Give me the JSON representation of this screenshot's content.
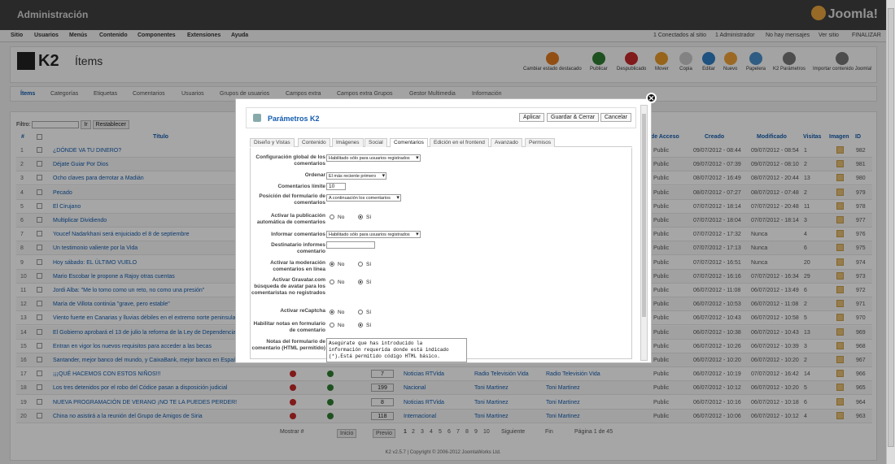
{
  "admin_title": "Administración",
  "joomla_logo": "Joomla!",
  "menu": [
    "Sitio",
    "Usuarios",
    "Menús",
    "Contenido",
    "Componentes",
    "Extensiones",
    "Ayuda"
  ],
  "status": [
    "1 Conectados al sitio",
    "1 Administrador",
    "No hay mensajes",
    "Ver sitio",
    "FINALIZAR"
  ],
  "page_title": "Ítems",
  "k2_logo": "K2",
  "toolbar": [
    {
      "label": "Cambiar estado destacado",
      "color": "#e07a1f"
    },
    {
      "label": "Publicar",
      "color": "#2e7d32"
    },
    {
      "label": "Despublicado",
      "color": "#c62828"
    },
    {
      "label": "Mover",
      "color": "#e89a2a"
    },
    {
      "label": "Copia",
      "color": "#c9c9c9"
    },
    {
      "label": "Editar",
      "color": "#2f7fc5"
    },
    {
      "label": "Nuevo",
      "color": "#f0a23a"
    },
    {
      "label": "Papelera",
      "color": "#4a8fc9"
    },
    {
      "label": "K2 Parámetros",
      "color": "#777777"
    },
    {
      "label": "Importar contenido Joomla!",
      "color": "#777777"
    }
  ],
  "subnav": [
    "Ítems",
    "Categorías",
    "Etiquetas",
    "Comentarios",
    "Usuarios",
    "Grupos de usuarios",
    "Campos extra",
    "Campos extra Grupos",
    "Gestor Multimedia",
    "Información"
  ],
  "filter": {
    "label": "Filtro:",
    "go": "Ir",
    "reset": "Restablecer"
  },
  "columns": {
    "num": "#",
    "title": "Título",
    "access": "de Acceso",
    "created": "Creado",
    "modified": "Modificado",
    "hits": "Visitas",
    "image": "Imagen",
    "id": "ID"
  },
  "rows": [
    {
      "n": "1",
      "title": "¿DÓNDE VA TU DINERO?",
      "order": "",
      "cat": "",
      "author": "",
      "moder": "",
      "access": "Public",
      "created": "09/07/2012 - 08:44",
      "modified": "09/07/2012 - 08:54",
      "hits": "1",
      "id": "982"
    },
    {
      "n": "2",
      "title": "Déjate Guiar Por Dios",
      "order": "",
      "cat": "",
      "author": "",
      "moder": "",
      "access": "Public",
      "created": "09/07/2012 - 07:39",
      "modified": "09/07/2012 - 08:10",
      "hits": "2",
      "id": "981"
    },
    {
      "n": "3",
      "title": "Ocho claves para derrotar a Madián",
      "order": "",
      "cat": "",
      "author": "",
      "moder": "",
      "access": "Public",
      "created": "08/07/2012 - 16:49",
      "modified": "08/07/2012 - 20:44",
      "hits": "13",
      "id": "980"
    },
    {
      "n": "4",
      "title": "Pecado",
      "order": "",
      "cat": "",
      "author": "",
      "moder": "",
      "access": "Public",
      "created": "08/07/2012 - 07:27",
      "modified": "08/07/2012 - 07:48",
      "hits": "2",
      "id": "979"
    },
    {
      "n": "5",
      "title": "El Cirujano",
      "order": "",
      "cat": "",
      "author": "",
      "moder": "",
      "access": "Public",
      "created": "07/07/2012 - 18:14",
      "modified": "07/07/2012 - 20:48",
      "hits": "11",
      "id": "978"
    },
    {
      "n": "6",
      "title": "Multiplicar Dividiendo",
      "order": "",
      "cat": "",
      "author": "",
      "moder": "",
      "access": "Public",
      "created": "07/07/2012 - 18:04",
      "modified": "07/07/2012 - 18:14",
      "hits": "3",
      "id": "977"
    },
    {
      "n": "7",
      "title": "Youcef Nadarkhani será enjuiciado el 8 de septiembre",
      "order": "",
      "cat": "",
      "author": "",
      "moder": "",
      "access": "Public",
      "created": "07/07/2012 - 17:32",
      "modified": "Nunca",
      "hits": "4",
      "id": "976"
    },
    {
      "n": "8",
      "title": "Un testimonio valiente por la Vida",
      "order": "",
      "cat": "",
      "author": "",
      "moder": "",
      "access": "Public",
      "created": "07/07/2012 - 17:13",
      "modified": "Nunca",
      "hits": "6",
      "id": "975"
    },
    {
      "n": "9",
      "title": "Hoy sábado: EL ÚLTIMO VUELO",
      "order": "",
      "cat": "",
      "author": "",
      "moder": "",
      "access": "Public",
      "created": "07/07/2012 - 16:51",
      "modified": "Nunca",
      "hits": "20",
      "id": "974"
    },
    {
      "n": "10",
      "title": "Mario Escobar le propone a Rajoy otras cuentas",
      "order": "",
      "cat": "",
      "author": "",
      "moder": "",
      "access": "Public",
      "created": "07/07/2012 - 16:16",
      "modified": "07/07/2012 - 16:34",
      "hits": "29",
      "id": "973"
    },
    {
      "n": "11",
      "title": "Jordi Alba: \"Me lo tomo como un reto, no como una presión\"",
      "order": "",
      "cat": "",
      "author": "",
      "moder": "",
      "access": "Public",
      "created": "06/07/2012 - 11:08",
      "modified": "06/07/2012 - 13:49",
      "hits": "6",
      "id": "972"
    },
    {
      "n": "12",
      "title": "María de Villota continúa \"grave, pero estable\"",
      "order": "",
      "cat": "",
      "author": "",
      "moder": "",
      "access": "Public",
      "created": "06/07/2012 - 10:53",
      "modified": "06/07/2012 - 11:08",
      "hits": "2",
      "id": "971"
    },
    {
      "n": "13",
      "title": "Viento fuerte en Canarias y lluvias débiles en el extremo norte peninsular",
      "order": "",
      "cat": "",
      "author": "",
      "moder": "",
      "access": "Public",
      "created": "06/07/2012 - 10:43",
      "modified": "06/07/2012 - 10:58",
      "hits": "5",
      "id": "970"
    },
    {
      "n": "14",
      "title": "El Gobierno aprobará el 13 de julio la reforma de la Ley de Dependencia",
      "order": "",
      "cat": "",
      "author": "",
      "moder": "",
      "access": "Public",
      "created": "06/07/2012 - 10:38",
      "modified": "06/07/2012 - 10:43",
      "hits": "13",
      "id": "969"
    },
    {
      "n": "15",
      "title": "Entran en vigor los nuevos requisitos para acceder a las becas",
      "order": "",
      "cat": "",
      "author": "",
      "moder": "",
      "access": "Public",
      "created": "06/07/2012 - 10:26",
      "modified": "06/07/2012 - 10:39",
      "hits": "3",
      "id": "968"
    },
    {
      "n": "16",
      "title": "Santander, mejor banco del mundo, y CaixaBank, mejor banco en España",
      "order": "",
      "cat": "",
      "author": "",
      "moder": "",
      "access": "Public",
      "created": "06/07/2012 - 10:20",
      "modified": "06/07/2012 - 10:20",
      "hits": "2",
      "id": "967"
    },
    {
      "n": "17",
      "title": "¡¡¡QUÉ HACEMOS CON ESTOS NIÑOS!!!",
      "order": "7",
      "cat": "Noticias RTVida",
      "author": "Radio Televisión Vida",
      "moder": "Radio Televisión Vida",
      "access": "Public",
      "created": "06/07/2012 - 10:19",
      "modified": "07/07/2012 - 16:42",
      "hits": "14",
      "id": "966"
    },
    {
      "n": "18",
      "title": "Los tres detenidos por el robo del Códice pasan a disposición judicial",
      "order": "199",
      "cat": "Nacional",
      "author": "Toni Martinez",
      "moder": "Toni Martinez",
      "access": "Public",
      "created": "06/07/2012 - 10:12",
      "modified": "06/07/2012 - 10:20",
      "hits": "5",
      "id": "965"
    },
    {
      "n": "19",
      "title": "NUEVA PROGRAMACIÓN DE VERANO ¡NO TE LA PUEDES PERDER!",
      "order": "8",
      "cat": "Noticias RTVida",
      "author": "Toni Martinez",
      "moder": "Toni Martinez",
      "access": "Public",
      "created": "06/07/2012 - 10:16",
      "modified": "06/07/2012 - 10:18",
      "hits": "6",
      "id": "964"
    },
    {
      "n": "20",
      "title": "China no asistirá a la reunión del Grupo de Amigos de Siria",
      "order": "118",
      "cat": "Internacional",
      "author": "Toni Martinez",
      "moder": "Toni Martinez",
      "access": "Public",
      "created": "06/07/2012 - 10:06",
      "modified": "06/07/2012 - 10:12",
      "hits": "4",
      "id": "963"
    }
  ],
  "pager": {
    "show": "Mostrar #",
    "start": "Inicio",
    "prev": "Previo",
    "pages": [
      "1",
      "2",
      "3",
      "4",
      "5",
      "6",
      "7",
      "8",
      "9",
      "10"
    ],
    "next": "Siguiente",
    "end": "Fin",
    "info": "Página 1 de 45"
  },
  "footer": "K2 v2.5.7 | Copyright © 2006-2012 JoomlaWorks Ltd.",
  "modal": {
    "title": "Parámetros K2",
    "buttons": [
      "Aplicar",
      "Guardar & Cerrar",
      "Cancelar"
    ],
    "tabs": [
      "Diseño y Vistas",
      "Contenido",
      "Imágenes",
      "Social",
      "Comentarios",
      "Edición en el frontend",
      "Avanzado",
      "Permisos"
    ],
    "active_tab": "Comentarios",
    "fields": {
      "global": {
        "label": "Configuración global de los comentarios",
        "value": "Habilitado sólo para usuarios registrados"
      },
      "order": {
        "label": "Ordenar",
        "value": "El más reciente primero"
      },
      "limit": {
        "label": "Comentarios límite",
        "value": "10"
      },
      "position": {
        "label": "Posición del formulario de comentarios",
        "value": "A continuación los comentarios"
      },
      "autopub": {
        "label": "Activar la publicación automática de comentarios",
        "no": "No",
        "si": "Sí",
        "selected": "si"
      },
      "report": {
        "label": "Informar comentarios",
        "value": "Habilitado sólo para usuarios registrados"
      },
      "recipient": {
        "label": "Destinatario informes comentario",
        "value": ""
      },
      "moderation": {
        "label": "Activar la moderación comentarios en línea",
        "no": "No",
        "si": "Sí",
        "selected": "no"
      },
      "gravatar": {
        "label": "Activar Gravatar.com búsqueda de avatar para los comentaristas no registrados",
        "no": "No",
        "si": "Sí",
        "selected": "si"
      },
      "recaptcha": {
        "label": "Activar reCaptcha",
        "no": "No",
        "si": "Sí",
        "selected": "no"
      },
      "notes": {
        "label": "Habilitar notas en formulario de comentario",
        "no": "No",
        "si": "Sí",
        "selected": "si"
      },
      "notes_text": {
        "label": "Notas del formulario de comentario (HTML permitido)",
        "value": "Asegúrate que has introducido la\ninformación requerida donde está indicado\n(*).Está permitido código HTML básico."
      }
    }
  }
}
